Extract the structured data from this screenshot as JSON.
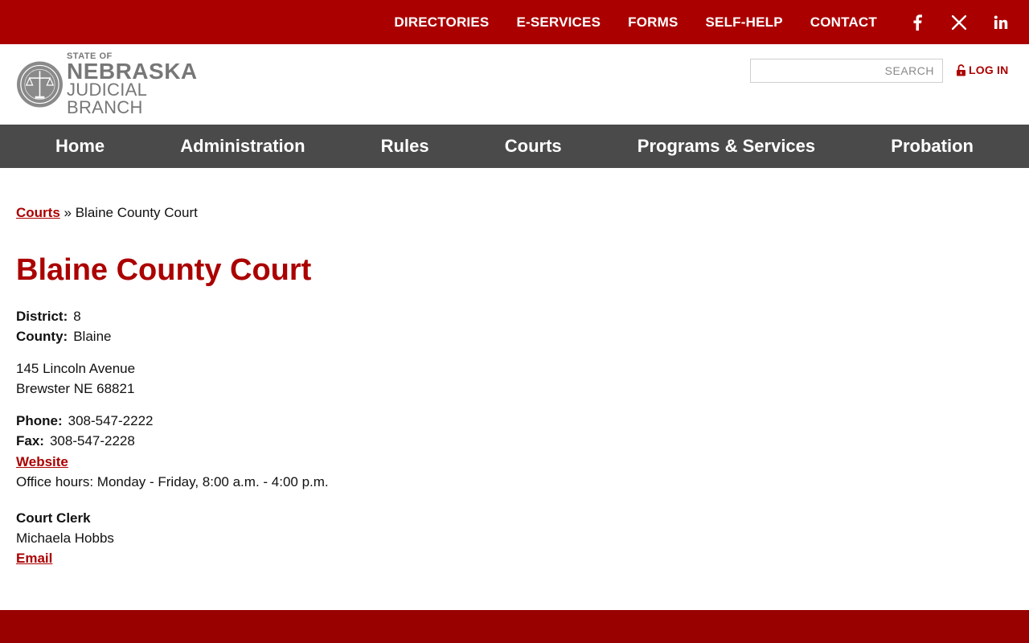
{
  "topbar": {
    "links": [
      "DIRECTORIES",
      "E-SERVICES",
      "FORMS",
      "SELF-HELP",
      "CONTACT"
    ],
    "socials": [
      "facebook-icon",
      "x-twitter-icon",
      "linkedin-icon"
    ]
  },
  "header": {
    "logo": {
      "line1": "STATE OF",
      "line2": "NEBRASKA",
      "line3": "JUDICIAL BRANCH"
    },
    "search_placeholder": "SEARCH",
    "login_label": "LOG IN"
  },
  "nav": {
    "items": [
      "Home",
      "Administration",
      "Rules",
      "Courts",
      "Programs & Services",
      "Probation"
    ]
  },
  "breadcrumb": {
    "link": "Courts",
    "separator": "»",
    "current": "Blaine County Court"
  },
  "court": {
    "title": "Blaine County Court",
    "district_label": "District:",
    "district": "8",
    "county_label": "County:",
    "county": "Blaine",
    "address_line1": "145 Lincoln Avenue",
    "address_line2": "Brewster NE 68821",
    "phone_label": "Phone:",
    "phone": "308-547-2222",
    "fax_label": "Fax:",
    "fax": "308-547-2228",
    "website_label": "Website",
    "office_hours": "Office hours: Monday - Friday, 8:00 a.m. - 4:00 p.m.",
    "clerk_title": "Court Clerk",
    "clerk_name": "Michaela Hobbs",
    "email_label": "Email"
  },
  "colors": {
    "brand_red": "#ab0000",
    "nav_gray": "#4a4a4a",
    "footer_red": "#990000"
  }
}
